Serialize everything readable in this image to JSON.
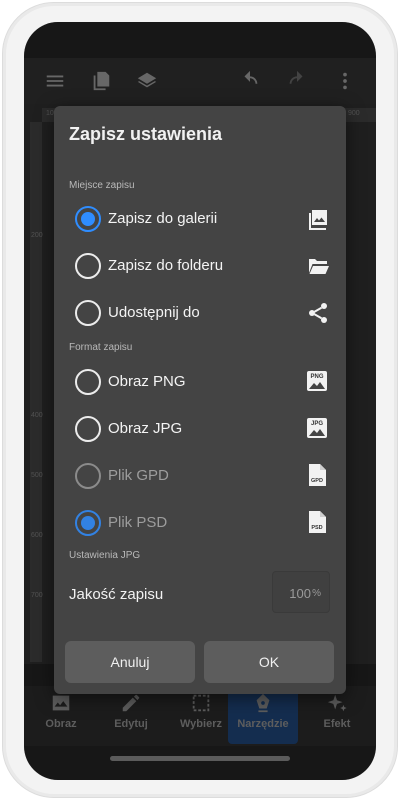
{
  "app": {
    "ruler_top": [
      "100",
      "900"
    ],
    "ruler_left": [
      "200",
      "400",
      "500",
      "600",
      "700"
    ],
    "bottom_nav": [
      {
        "label": "Obraz",
        "icon": "image-icon"
      },
      {
        "label": "Edytuj",
        "icon": "pencil-icon"
      },
      {
        "label": "Wybierz",
        "icon": "select-icon"
      },
      {
        "label": "Narzędzie",
        "icon": "pen-tool-icon",
        "active": true
      },
      {
        "label": "Efekt",
        "icon": "sparkle-icon"
      }
    ]
  },
  "dialog": {
    "title": "Zapisz ustawienia",
    "location_section": "Miejsce zapisu",
    "location_options": [
      {
        "label": "Zapisz do galerii",
        "checked": true,
        "icon": "gallery-icon"
      },
      {
        "label": "Zapisz do folderu",
        "checked": false,
        "icon": "folder-icon"
      },
      {
        "label": "Udostępnij do",
        "checked": false,
        "icon": "share-icon"
      }
    ],
    "format_section": "Format zapisu",
    "format_options": [
      {
        "label": "Obraz PNG",
        "checked": false,
        "badge": "PNG",
        "icon": "png-file-icon"
      },
      {
        "label": "Obraz JPG",
        "checked": false,
        "badge": "JPG",
        "icon": "jpg-file-icon"
      },
      {
        "label": "Plik GPD",
        "checked": false,
        "disabled": true,
        "badge": "GPD",
        "icon": "gpd-file-icon"
      },
      {
        "label": "Plik PSD",
        "checked": true,
        "disabled": true,
        "badge": "PSD",
        "icon": "psd-file-icon"
      }
    ],
    "jpg_section": "Ustawienia JPG",
    "quality_label": "Jakość zapisu",
    "quality_value": "100",
    "quality_unit": "%",
    "cancel_label": "Anuluj",
    "ok_label": "OK",
    "accent_color": "#2f8dff"
  }
}
